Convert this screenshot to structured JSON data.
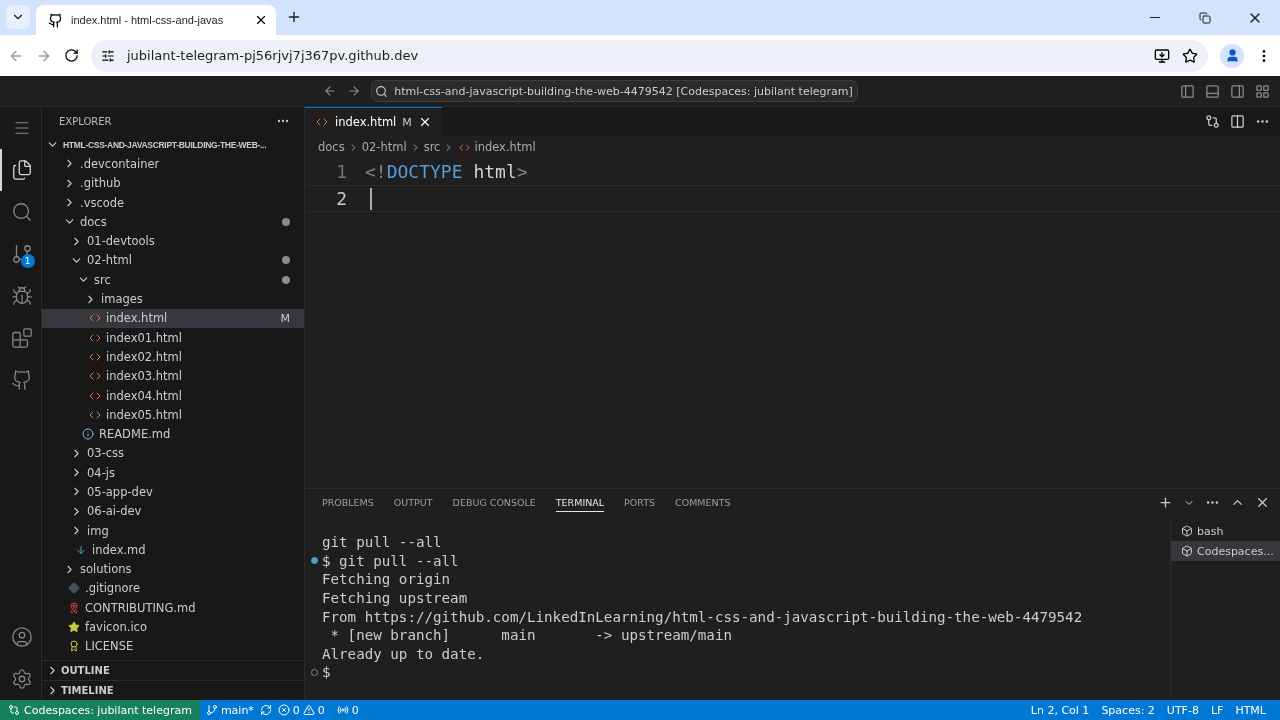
{
  "browser": {
    "tab_title": "index.html - html-css-and-javas",
    "url": "jubilant-telegram-pj56rjvj7j367pv.github.dev"
  },
  "title_bar": {
    "command_center": "html-css-and-javascript-building-the-web-4479542 [Codespaces: jubilant telegram]"
  },
  "activity_bar": [
    {
      "kind": "explorer",
      "selected": true
    },
    {
      "kind": "search",
      "selected": false
    },
    {
      "kind": "scm",
      "selected": false,
      "badge": "1"
    },
    {
      "kind": "run",
      "selected": false
    },
    {
      "kind": "extensions",
      "selected": false
    },
    {
      "kind": "github",
      "selected": false
    }
  ],
  "sidebar": {
    "title": "EXPLORER",
    "root": "HTML-CSS-AND-JAVASCRIPT-BUILDING-THE-WEB-...",
    "items": [
      {
        "label": ".devcontainer",
        "kind": "folder",
        "expanded": false
      },
      {
        "label": ".github",
        "kind": "folder",
        "expanded": false
      },
      {
        "label": ".vscode",
        "kind": "folder",
        "expanded": false
      },
      {
        "label": "docs",
        "kind": "folder",
        "expanded": true,
        "dirty": true,
        "children": [
          {
            "label": "01-devtools",
            "kind": "folder",
            "expanded": false
          },
          {
            "label": "02-html",
            "kind": "folder",
            "expanded": true,
            "dirty": true,
            "children": [
              {
                "label": "src",
                "kind": "folder",
                "expanded": true,
                "dirty": true,
                "children": [
                  {
                    "label": "images",
                    "kind": "folder",
                    "expanded": false
                  },
                  {
                    "label": "index.html",
                    "kind": "html",
                    "selected": true,
                    "badge": "M"
                  },
                  {
                    "label": "index01.html",
                    "kind": "html",
                    "selected": false
                  },
                  {
                    "label": "index02.html",
                    "kind": "html",
                    "selected": false
                  },
                  {
                    "label": "index03.html",
                    "kind": "html",
                    "selected": false
                  },
                  {
                    "label": "index04.html",
                    "kind": "html",
                    "selected": false
                  },
                  {
                    "label": "index05.html",
                    "kind": "html",
                    "selected": false
                  }
                ]
              },
              {
                "label": "README.md",
                "kind": "info",
                "selected": false
              }
            ]
          },
          {
            "label": "03-css",
            "kind": "folder",
            "expanded": false
          },
          {
            "label": "04-js",
            "kind": "folder",
            "expanded": false
          },
          {
            "label": "05-app-dev",
            "kind": "folder",
            "expanded": false
          },
          {
            "label": "06-ai-dev",
            "kind": "folder",
            "expanded": false
          },
          {
            "label": "img",
            "kind": "folder",
            "expanded": false
          },
          {
            "label": "index.md",
            "kind": "markdown",
            "selected": false
          }
        ]
      },
      {
        "label": "solutions",
        "kind": "folder",
        "expanded": false
      },
      {
        "label": ".gitignore",
        "kind": "gitignore",
        "selected": false
      },
      {
        "label": "CONTRIBUTING.md",
        "kind": "ribbon",
        "selected": false
      },
      {
        "label": "favicon.ico",
        "kind": "star",
        "selected": false
      },
      {
        "label": "LICENSE",
        "kind": "license",
        "selected": false
      }
    ],
    "sections": [
      {
        "label": "OUTLINE",
        "expanded": false
      },
      {
        "label": "TIMELINE",
        "expanded": false
      }
    ]
  },
  "editor": {
    "tab": {
      "label": "index.html",
      "badge": "M"
    },
    "breadcrumb": [
      "docs",
      "02-html",
      "src",
      "index.html"
    ],
    "lines": [
      {
        "number": "1",
        "tokens": [
          {
            "kind": "punct",
            "text": "<!"
          },
          {
            "kind": "keyword",
            "text": "DOCTYPE"
          },
          {
            "kind": "plain",
            "text": " html"
          },
          {
            "kind": "punct",
            "text": ">"
          }
        ]
      },
      {
        "number": "2",
        "cursor": true
      }
    ]
  },
  "panel": {
    "tabs": [
      {
        "label": "PROBLEMS",
        "selected": false
      },
      {
        "label": "OUTPUT",
        "selected": false
      },
      {
        "label": "DEBUG CONSOLE",
        "selected": false
      },
      {
        "label": "TERMINAL",
        "selected": true
      },
      {
        "label": "PORTS",
        "selected": false
      },
      {
        "label": "COMMENTS",
        "selected": false
      }
    ],
    "terminal_lines": [
      {
        "text": "git pull --all",
        "marked": false
      },
      {
        "text": "$ git pull --all",
        "marked": true,
        "succeeded": true
      },
      {
        "text": "Fetching origin",
        "marked": false
      },
      {
        "text": "Fetching upstream",
        "marked": false
      },
      {
        "text": "From https://github.com/LinkedInLearning/html-css-and-javascript-building-the-web-4479542",
        "marked": false
      },
      {
        "text": " * [new branch]      main       -> upstream/main",
        "marked": false
      },
      {
        "text": "Already up to date.",
        "marked": false
      },
      {
        "text": "$",
        "marked": true,
        "succeeded": false
      }
    ],
    "terminals": [
      {
        "label": "bash",
        "selected": false
      },
      {
        "label": "Codespaces...",
        "selected": true
      }
    ]
  },
  "status_bar": {
    "remote": "Codespaces: jubilant telegram",
    "branch": "main*",
    "errors": "0",
    "warnings": "0",
    "ports": "0",
    "right": [
      "Ln 2, Col 1",
      "Spaces: 2",
      "UTF-8",
      "LF",
      "HTML"
    ]
  }
}
